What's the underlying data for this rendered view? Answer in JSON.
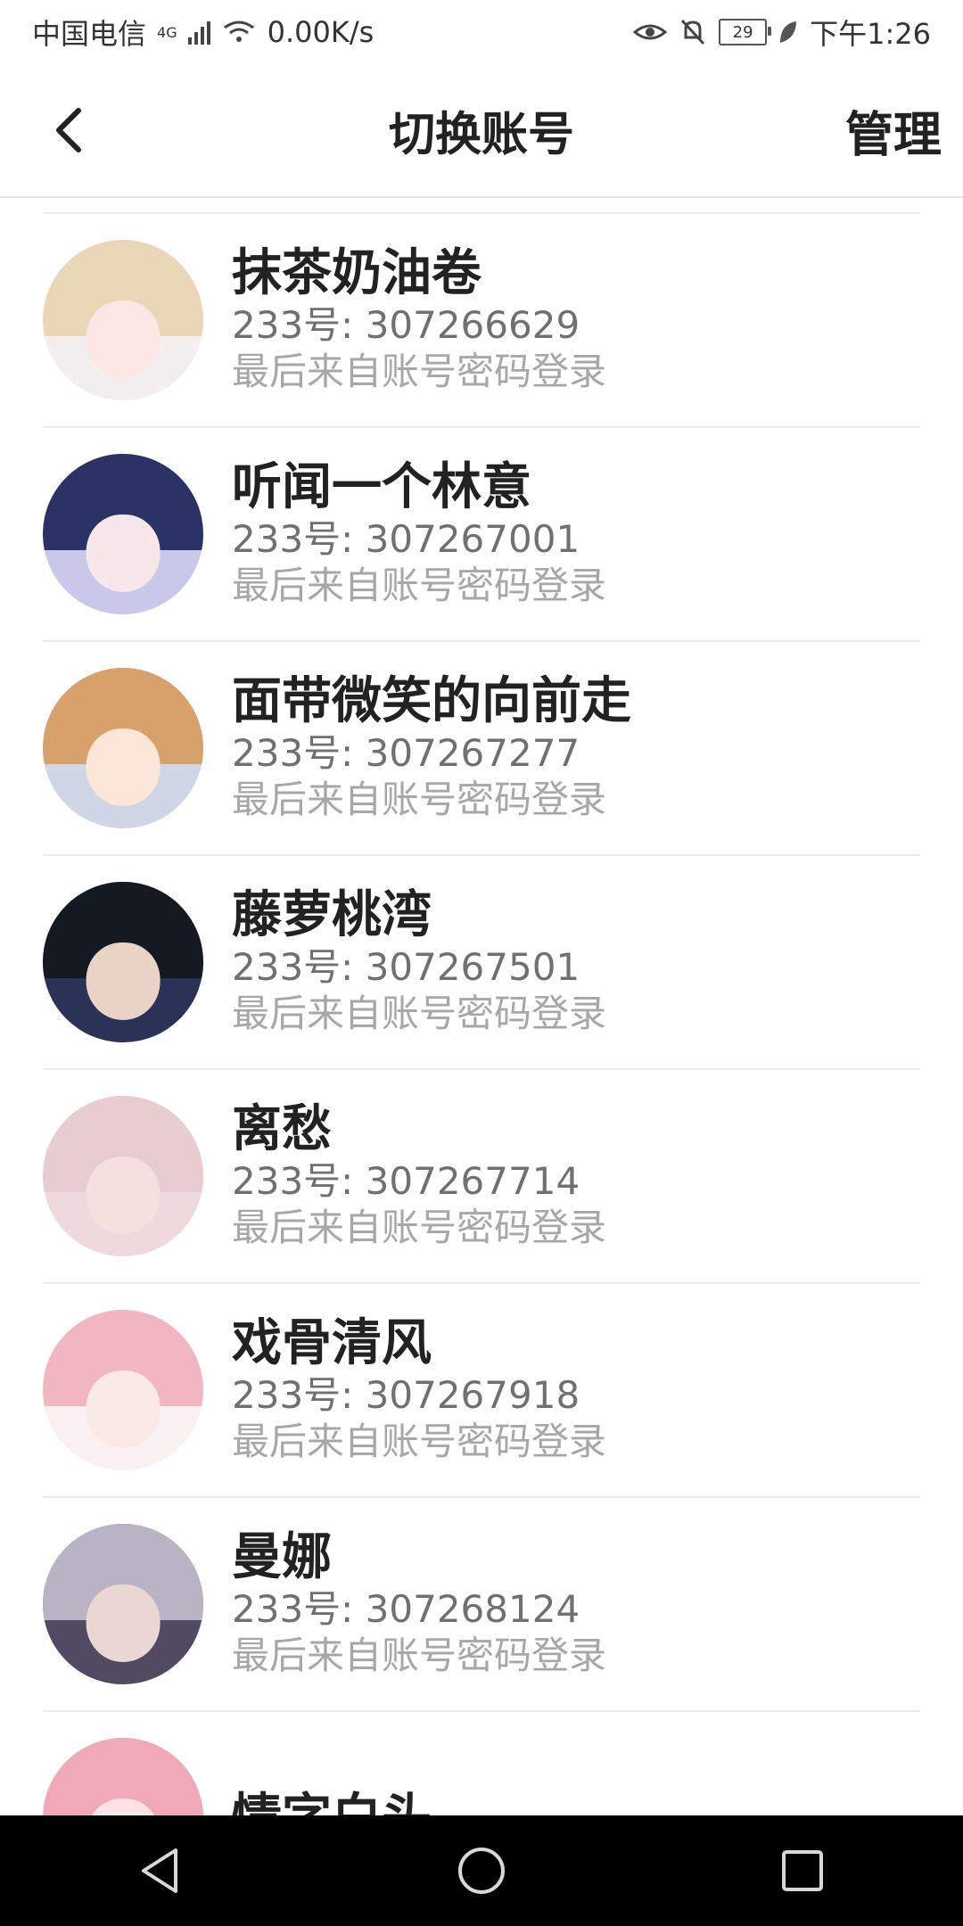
{
  "status_bar": {
    "carrier": "中国电信",
    "network": "4G",
    "speed": "0.00K/s",
    "battery": "29",
    "time": "下午1:26"
  },
  "app_bar": {
    "title": "切换账号",
    "manage_label": "管理"
  },
  "accounts": [
    {
      "name": "抹茶奶油卷",
      "uid": "233号: 307266629",
      "note": "最后来自账号密码登录",
      "bg": "#f3eef0",
      "hair": "#ead7b8",
      "face": "#fbe7e3"
    },
    {
      "name": "听闻一个林意",
      "uid": "233号: 307267001",
      "note": "最后来自账号密码登录",
      "bg": "#c9c7ea",
      "hair": "#2b3266",
      "face": "#f7e6ea"
    },
    {
      "name": "面带微笑的向前走",
      "uid": "233号: 307267277",
      "note": "最后来自账号密码登录",
      "bg": "#cfd6e6",
      "hair": "#d8a06a",
      "face": "#fbe6d7"
    },
    {
      "name": "藤萝桃湾",
      "uid": "233号: 307267501",
      "note": "最后来自账号密码登录",
      "bg": "#2a3258",
      "hair": "#151922",
      "face": "#e9d3c7"
    },
    {
      "name": "离愁",
      "uid": "233号: 307267714",
      "note": "最后来自账号密码登录",
      "bg": "#efd9dc",
      "hair": "#e7cdd0",
      "face": "#f6dfdf"
    },
    {
      "name": "戏骨清风",
      "uid": "233号: 307267918",
      "note": "最后来自账号密码登录",
      "bg": "#fbf0f0",
      "hair": "#f2b6c2",
      "face": "#fbe9e6"
    },
    {
      "name": "曼娜",
      "uid": "233号: 307268124",
      "note": "最后来自账号密码登录",
      "bg": "#524a63",
      "hair": "#b9b3c3",
      "face": "#ead6d3"
    },
    {
      "name": "情字白头",
      "uid": "",
      "note": "",
      "bg": "#f4d2d8",
      "hair": "#f0a9b6",
      "face": "#fbe2e4"
    }
  ]
}
